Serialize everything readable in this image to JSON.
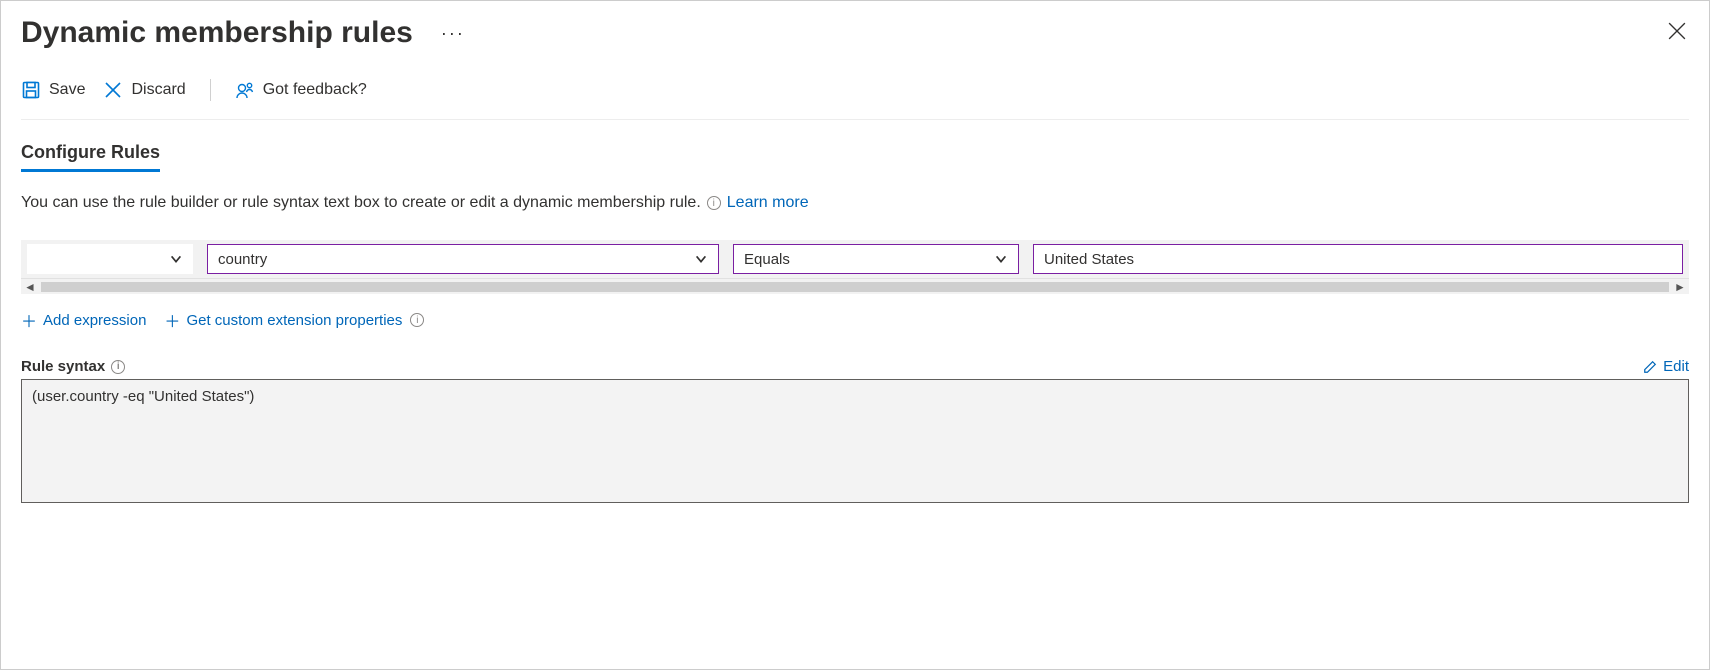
{
  "header": {
    "title": "Dynamic membership rules"
  },
  "toolbar": {
    "save_label": "Save",
    "discard_label": "Discard",
    "feedback_label": "Got feedback?"
  },
  "tab": {
    "configure_label": "Configure Rules"
  },
  "description": {
    "text": "You can use the rule builder or rule syntax text box to create or edit a dynamic membership rule.",
    "learn_more": "Learn more"
  },
  "rule_row": {
    "property": "country",
    "operator": "Equals",
    "value": "United States"
  },
  "actions": {
    "add_expression": "Add expression",
    "get_custom_ext": "Get custom extension properties"
  },
  "syntax": {
    "label": "Rule syntax",
    "edit": "Edit",
    "value": "(user.country -eq \"United States\")"
  }
}
